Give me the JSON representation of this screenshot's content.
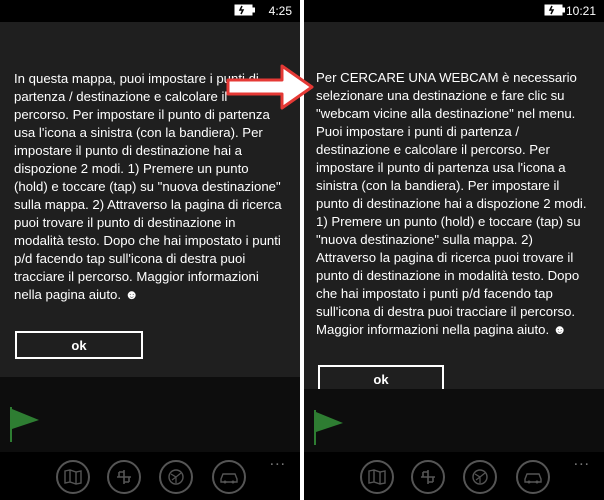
{
  "colors": {
    "background": "#000000",
    "dialog": "#1f1f1f",
    "text": "#ffffff",
    "flag": "#2e7d32",
    "appbar_icon": "#555555",
    "arrow": "#e53935"
  },
  "left": {
    "status": {
      "time": "4:25"
    },
    "dialog": {
      "message": "In questa mappa, puoi impostare i punti di partenza / destinazione e calcolare il percorso. Per impostare il punto di partenza usa l'icona a sinistra (con la bandiera). Per impostare il punto di destinazione hai a dispozione 2 modi. 1) Premere un punto (hold) e toccare (tap) su \"nuova destinazione\" sulla mappa. 2) Attraverso la pagina di ricerca puoi trovare il punto di destinazione in modalità testo. Dopo che hai impostato i punti p/d facendo tap sull'icona di destra puoi tracciare il percorso.  Maggior informazioni nella pagina aiuto. ☻",
      "ok_label": "ok"
    },
    "appbar": {
      "more": "..."
    }
  },
  "right": {
    "status": {
      "time": "10:21"
    },
    "dialog": {
      "message": "Per CERCARE UNA WEBCAM è necessario selezionare una destinazione e fare clic su \"webcam vicine alla destinazione\" nel menu. Puoi impostare i punti di partenza / destinazione e calcolare il percorso. Per impostare il punto di partenza usa l'icona a sinistra (con la bandiera). Per impostare il punto di destinazione hai a dispozione 2 modi. 1) Premere un punto (hold) e toccare (tap) su \"nuova destinazione\" sulla mappa. 2) Attraverso la pagina di ricerca puoi trovare il punto di destinazione in modalità testo. Dopo che hai impostato i punti p/d facendo tap sull'icona di destra puoi tracciare il percorso.  Maggior informazioni nella pagina aiuto. ☻",
      "ok_label": "ok"
    },
    "appbar": {
      "more": "..."
    }
  },
  "appbar_icons": [
    "map-book-icon",
    "route-icon",
    "satellite-map-icon",
    "car-icon"
  ]
}
